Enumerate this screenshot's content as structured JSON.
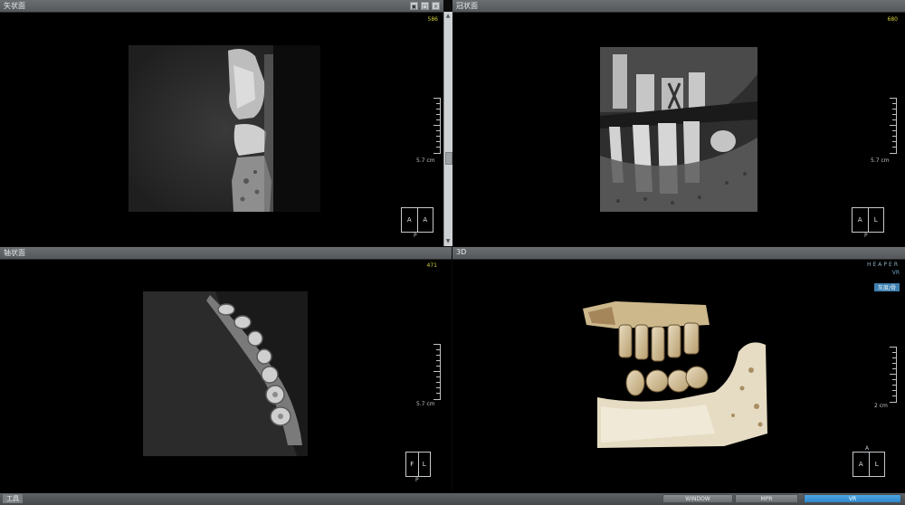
{
  "panes": {
    "top_left": {
      "title": "矢状面",
      "corner_label": "586",
      "scale_label": "5.7 cm",
      "orient": [
        "A",
        "A"
      ],
      "orient_sub": "P"
    },
    "top_right": {
      "title": "冠状面",
      "corner_label": "680",
      "scale_label": "5.7 cm",
      "orient": [
        "A",
        "L"
      ],
      "orient_sub": "P"
    },
    "bottom_left": {
      "title": "轴状面",
      "corner_label": "471",
      "scale_label": "5.7 cm",
      "orient": [
        "F",
        "L"
      ],
      "orient_sub": "P"
    },
    "bottom_right": {
      "title": "3D",
      "scale_label": "2 cm",
      "orient": [
        "A",
        "L"
      ],
      "orient_sub": "A",
      "rendering": {
        "title": "HEAPER",
        "sub": "VR",
        "button": "灰度/骨"
      }
    }
  },
  "statusbar": {
    "left_label": "工具",
    "buttons": [
      "WINDOW",
      "MPR",
      "VR"
    ]
  },
  "colors": {
    "accent": "#2f86c8",
    "label_yellow": "#d6d03a"
  }
}
